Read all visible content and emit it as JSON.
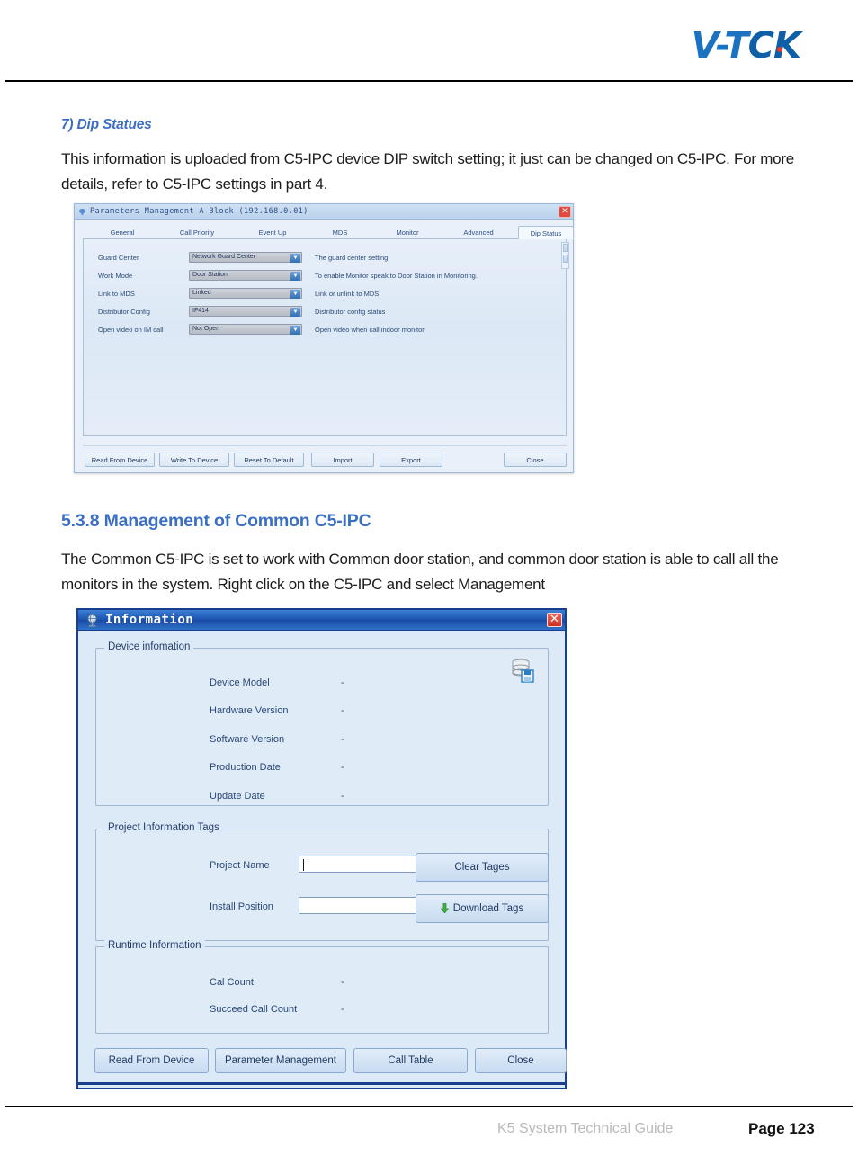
{
  "header": {
    "logo_text_1": "V-T",
    "logo_text_2": "CK",
    "logo_accent": "#e8392a",
    "logo_color": "#1a72c0"
  },
  "document": {
    "sub_heading": "7) Dip Statues",
    "paragraph_1": "This information is uploaded from C5-IPC device DIP switch setting; it just can be changed on C5-IPC. For more details, refer to C5-IPC settings in part 4.",
    "section_heading": "5.3.8 Management of Common C5-IPC",
    "paragraph_2": "The Common C5-IPC is set to work with Common door station, and common door station is able to call all the monitors in the system. Right click on the C5-IPC and select Management"
  },
  "footer": {
    "guide_text": "K5 System Technical Guide",
    "page_text": "Page 123"
  },
  "dialog_parameters": {
    "title": "Parameters Management A Block (192.168.0.01)",
    "close_label": "✕",
    "tabs": [
      {
        "label": "General",
        "selected": false
      },
      {
        "label": "Call Priority",
        "selected": false
      },
      {
        "label": "Event Up",
        "selected": false
      },
      {
        "label": "MDS",
        "selected": false
      },
      {
        "label": "Monitor",
        "selected": false
      },
      {
        "label": "Advanced",
        "selected": false
      },
      {
        "label": "Dip Status",
        "selected": true
      }
    ],
    "rows": [
      {
        "label": "Guard Center",
        "value": "Network Guard Center",
        "description": "The guard center setting"
      },
      {
        "label": "Work Mode",
        "value": "Door Station",
        "description": "To enable Monitor speak to Door Station in Monitoring."
      },
      {
        "label": "Link to MDS",
        "value": "Linked",
        "description": "Link or unlink to MDS"
      },
      {
        "label": "Distributor Config",
        "value": "IF414",
        "description": "Distributor config status"
      },
      {
        "label": "Open video on IM call",
        "value": "Not Open",
        "description": "Open video when call indoor monitor"
      }
    ],
    "buttons": [
      {
        "label": "Read From Device"
      },
      {
        "label": "Write To Device"
      },
      {
        "label": "Reset To Default"
      },
      {
        "label": "Import"
      },
      {
        "label": "Export"
      },
      {
        "label": "Close"
      }
    ]
  },
  "dialog_information": {
    "title": "Information",
    "close_label": "✕",
    "device_information": {
      "legend": "Device infomation",
      "fields": [
        {
          "label": "Device Model",
          "value": "-"
        },
        {
          "label": "Hardware Version",
          "value": "-"
        },
        {
          "label": "Software Version",
          "value": "-"
        },
        {
          "label": "Production Date",
          "value": "-"
        },
        {
          "label": "Update Date",
          "value": "-"
        }
      ]
    },
    "project_tags": {
      "legend": "Project Information Tags",
      "project_name_label": "Project Name",
      "project_name_value": "",
      "install_position_label": "Install Position",
      "install_position_value": "",
      "clear_button": "Clear Tages",
      "download_button": "Download Tags"
    },
    "runtime_information": {
      "legend": "Runtime Information",
      "fields": [
        {
          "label": "Cal Count",
          "value": "-"
        },
        {
          "label": "Succeed Call Count",
          "value": "-"
        }
      ]
    },
    "buttons": [
      {
        "label": "Read From Device"
      },
      {
        "label": "Parameter Management"
      },
      {
        "label": "Call Table"
      },
      {
        "label": "Close"
      }
    ]
  }
}
